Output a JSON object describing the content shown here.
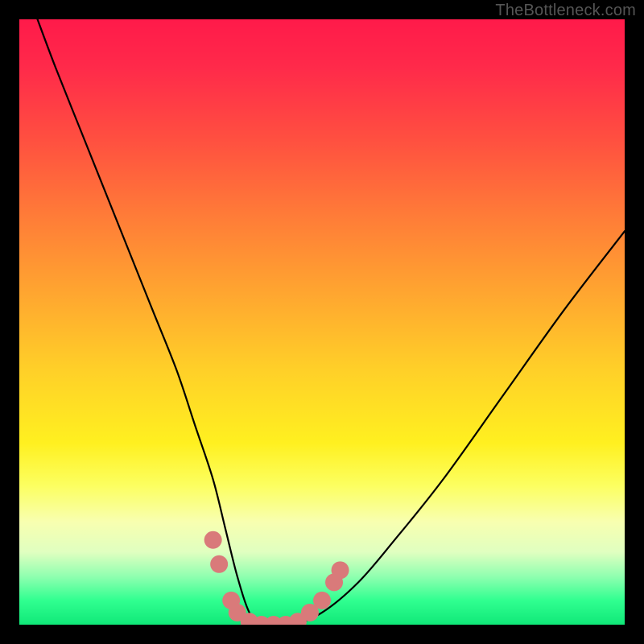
{
  "watermark": "TheBottleneck.com",
  "chart_data": {
    "type": "line",
    "title": "",
    "xlabel": "",
    "ylabel": "",
    "xlim": [
      0,
      100
    ],
    "ylim": [
      0,
      100
    ],
    "series": [
      {
        "name": "bottleneck-curve",
        "x": [
          3,
          6,
          10,
          14,
          18,
          22,
          26,
          29,
          32,
          34,
          36,
          38,
          40,
          45,
          50,
          56,
          62,
          70,
          80,
          90,
          100
        ],
        "y": [
          100,
          92,
          82,
          72,
          62,
          52,
          42,
          33,
          24,
          16,
          8,
          2,
          0,
          0,
          2,
          7,
          14,
          24,
          38,
          52,
          65
        ]
      }
    ],
    "markers": {
      "name": "highlight-dots",
      "color": "#d97a7a",
      "points": [
        {
          "x": 32,
          "y": 14
        },
        {
          "x": 33,
          "y": 10
        },
        {
          "x": 35,
          "y": 4
        },
        {
          "x": 36,
          "y": 2
        },
        {
          "x": 38,
          "y": 0.5
        },
        {
          "x": 40,
          "y": 0
        },
        {
          "x": 42,
          "y": 0
        },
        {
          "x": 44,
          "y": 0
        },
        {
          "x": 46,
          "y": 0.5
        },
        {
          "x": 48,
          "y": 2
        },
        {
          "x": 50,
          "y": 4
        },
        {
          "x": 52,
          "y": 7
        },
        {
          "x": 53,
          "y": 9
        }
      ]
    }
  }
}
